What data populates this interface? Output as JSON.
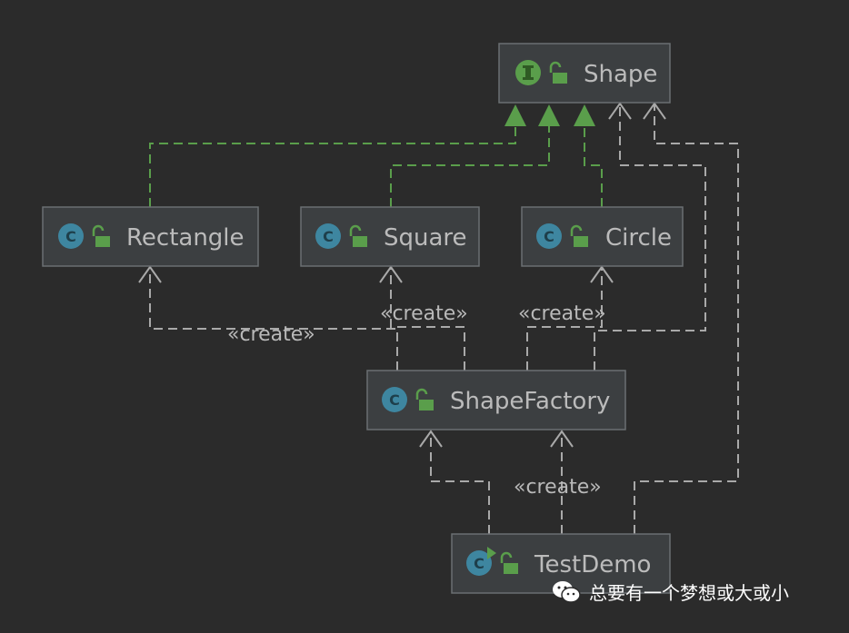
{
  "nodes": {
    "shape": {
      "label": "Shape",
      "kind": "interface",
      "badge": "I"
    },
    "rectangle": {
      "label": "Rectangle",
      "kind": "class",
      "badge": "C"
    },
    "square": {
      "label": "Square",
      "kind": "class",
      "badge": "C"
    },
    "circle": {
      "label": "Circle",
      "kind": "class",
      "badge": "C"
    },
    "shape_factory": {
      "label": "ShapeFactory",
      "kind": "class",
      "badge": "C"
    },
    "test_demo": {
      "label": "TestDemo",
      "kind": "main-class",
      "badge": "C"
    }
  },
  "edges": {
    "create_label": "«create»"
  },
  "colors": {
    "background": "#2b2b2b",
    "node_fill": "#3c3f41",
    "node_border": "#6b6f72",
    "text": "#bbbbbb",
    "implements": "#5a9e4b",
    "dependency": "#a9a9a9",
    "class_badge": "#3e86a0",
    "interface_badge": "#5a9e4b"
  },
  "watermark": {
    "icon": "wechat-icon",
    "text": "总要有一个梦想或大或小"
  }
}
